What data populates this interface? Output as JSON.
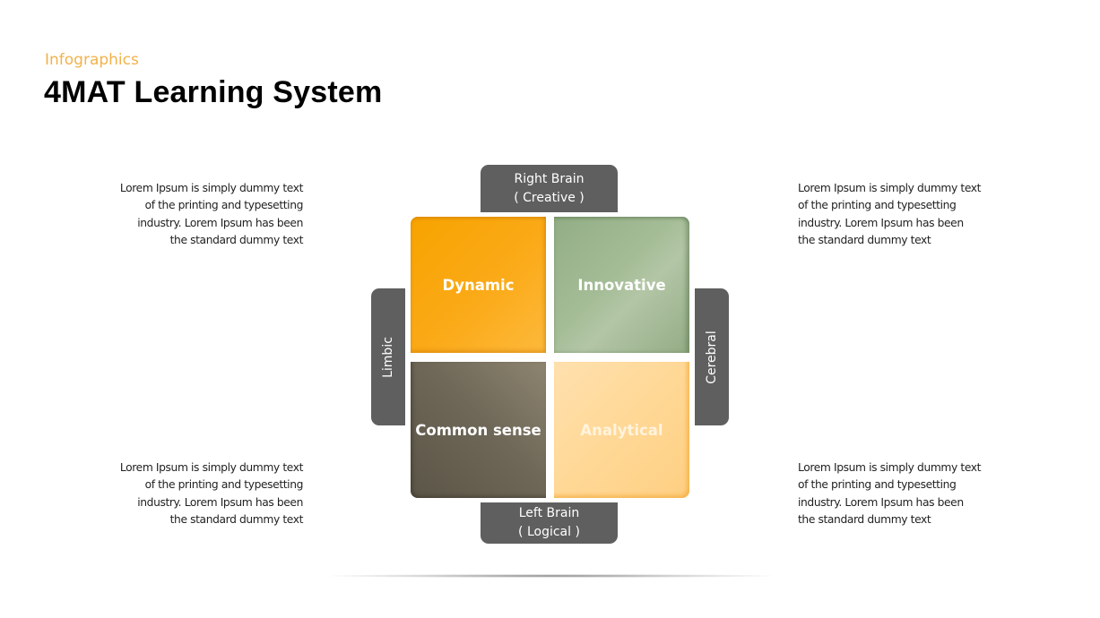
{
  "header": {
    "subtitle": "Infographics",
    "title": "4MAT Learning System"
  },
  "colors": {
    "subtitle": "#f2b24a",
    "tab": "#5f5f5f",
    "dynamic": "#f7a300",
    "innovative": "#9fb892",
    "common_sense": "#6f6858",
    "analytical": "#ffd896"
  },
  "tabs": {
    "top": {
      "line1": "Right Brain",
      "line2": "( Creative )"
    },
    "bottom": {
      "line1": "Left Brain",
      "line2": "( Logical )"
    },
    "left": {
      "label": "Limbic"
    },
    "right": {
      "label": "Cerebral"
    }
  },
  "quadrants": [
    {
      "label": "Dynamic"
    },
    {
      "label": "Innovative"
    },
    {
      "label": "Common sense"
    },
    {
      "label": "Analytical"
    }
  ],
  "descriptions": [
    {
      "lines": [
        "Lorem Ipsum is simply dummy text",
        "of the printing and typesetting",
        "industry. Lorem Ipsum has been",
        "the standard dummy text"
      ]
    },
    {
      "lines": [
        "Lorem Ipsum is simply dummy text",
        "of the printing and typesetting",
        "industry. Lorem Ipsum has been",
        "the standard dummy text"
      ]
    },
    {
      "lines": [
        "Lorem Ipsum is simply dummy text",
        "of the printing and typesetting",
        "industry. Lorem Ipsum has been",
        "the standard dummy text"
      ]
    },
    {
      "lines": [
        "Lorem Ipsum is simply dummy text",
        "of the printing and typesetting",
        "industry. Lorem Ipsum has been",
        "the standard dummy text"
      ]
    }
  ]
}
